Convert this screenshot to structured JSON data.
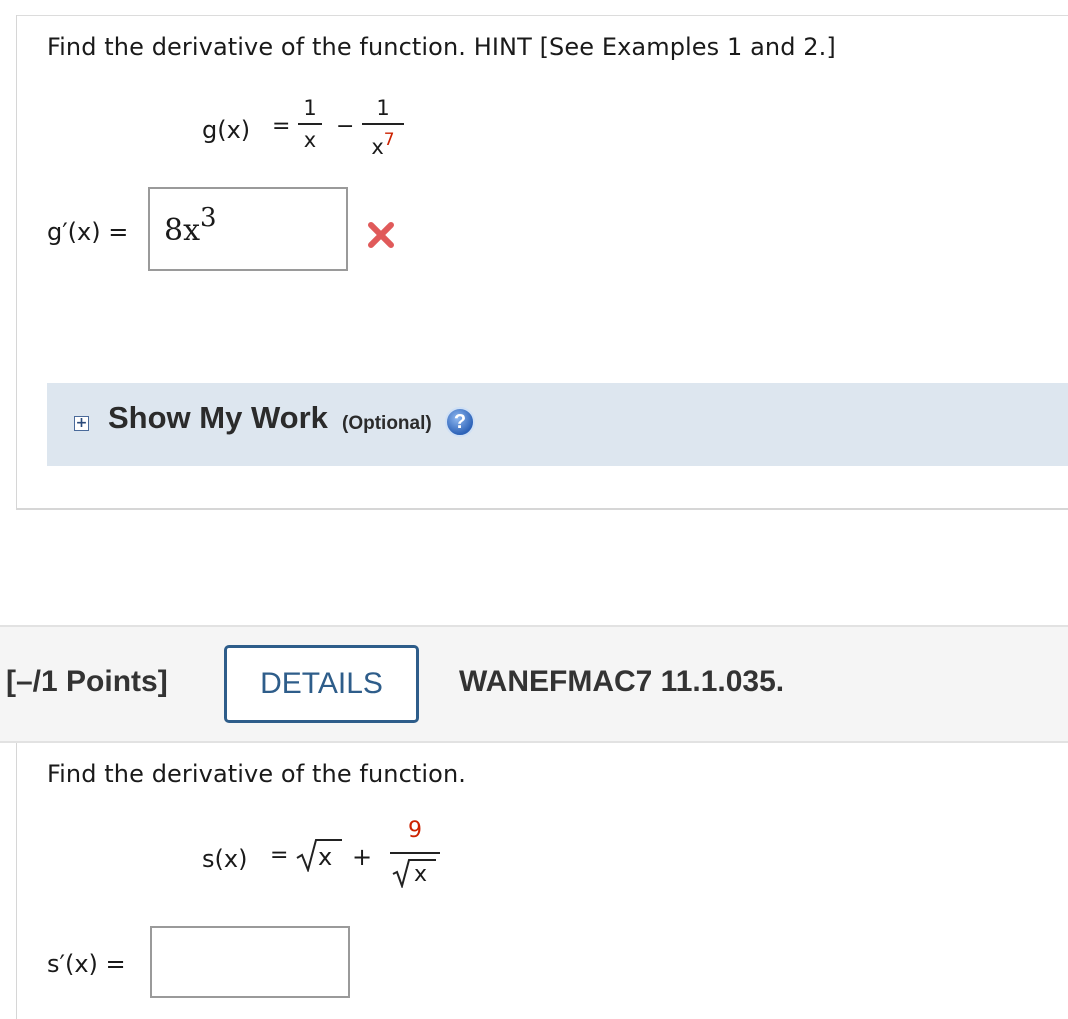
{
  "q1": {
    "prompt": "Find the derivative of the function. HINT [See Examples 1 and 2.]",
    "func_label": "g(x)",
    "equals": "=",
    "term1_num": "1",
    "term1_den": "x",
    "minus": "−",
    "term2_num": "1",
    "term2_den_base": "x",
    "term2_den_exp": "7",
    "answer_label": "g′(x)",
    "answer_value_base": "8x",
    "answer_value_exp": "3",
    "status_icon": "incorrect-x-icon"
  },
  "show_work": {
    "plus": "+",
    "title": "Show My Work",
    "optional": "(Optional)",
    "help": "?"
  },
  "q2_header": {
    "points": "[–/1 Points]",
    "details_label": "DETAILS",
    "problem_id": "WANEFMAC7 11.1.035."
  },
  "q2": {
    "prompt": "Find the derivative of the function.",
    "func_label": "s(x)",
    "equals": "=",
    "radicand": "x",
    "plus": "+",
    "frac_num": "9",
    "frac_den_radicand": "x",
    "answer_label": "s′(x)",
    "answer_value": ""
  },
  "colors": {
    "accent": "#2e5d8a",
    "highlight": "#cc2200",
    "incorrect": "#e05a5a",
    "show_work_bg": "#dde6ef"
  }
}
